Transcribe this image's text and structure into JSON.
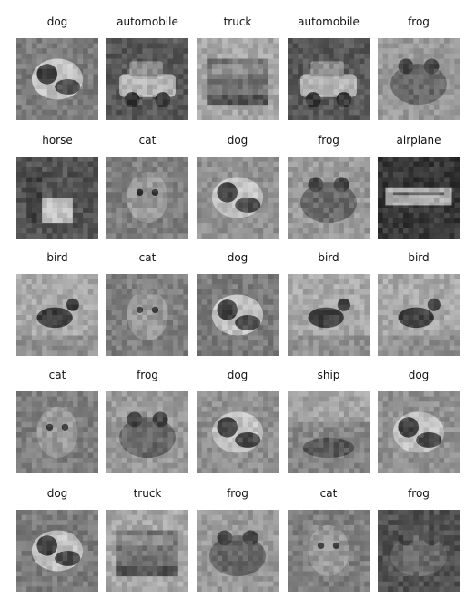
{
  "figure": {
    "items": [
      {
        "label": "dog",
        "depicts": "dog-photo"
      },
      {
        "label": "automobile",
        "depicts": "automobile-photo"
      },
      {
        "label": "truck",
        "depicts": "truck-photo"
      },
      {
        "label": "automobile",
        "depicts": "automobile-photo"
      },
      {
        "label": "frog",
        "depicts": "frog-photo"
      },
      {
        "label": "horse",
        "depicts": "horse-photo"
      },
      {
        "label": "cat",
        "depicts": "cat-photo"
      },
      {
        "label": "dog",
        "depicts": "dog-photo"
      },
      {
        "label": "frog",
        "depicts": "frog-photo"
      },
      {
        "label": "airplane",
        "depicts": "airplane-photo"
      },
      {
        "label": "bird",
        "depicts": "bird-photo"
      },
      {
        "label": "cat",
        "depicts": "cat-photo"
      },
      {
        "label": "dog",
        "depicts": "dog-photo"
      },
      {
        "label": "bird",
        "depicts": "bird-photo"
      },
      {
        "label": "bird",
        "depicts": "bird-photo"
      },
      {
        "label": "cat",
        "depicts": "cat-photo"
      },
      {
        "label": "frog",
        "depicts": "frog-photo"
      },
      {
        "label": "dog",
        "depicts": "dog-photo"
      },
      {
        "label": "ship",
        "depicts": "ship-photo"
      },
      {
        "label": "dog",
        "depicts": "dog-photo"
      },
      {
        "label": "dog",
        "depicts": "dog-photo"
      },
      {
        "label": "truck",
        "depicts": "truck-photo"
      },
      {
        "label": "frog",
        "depicts": "frog-photo"
      },
      {
        "label": "cat",
        "depicts": "cat-photo"
      },
      {
        "label": "frog",
        "depicts": "frog-photo"
      }
    ]
  }
}
